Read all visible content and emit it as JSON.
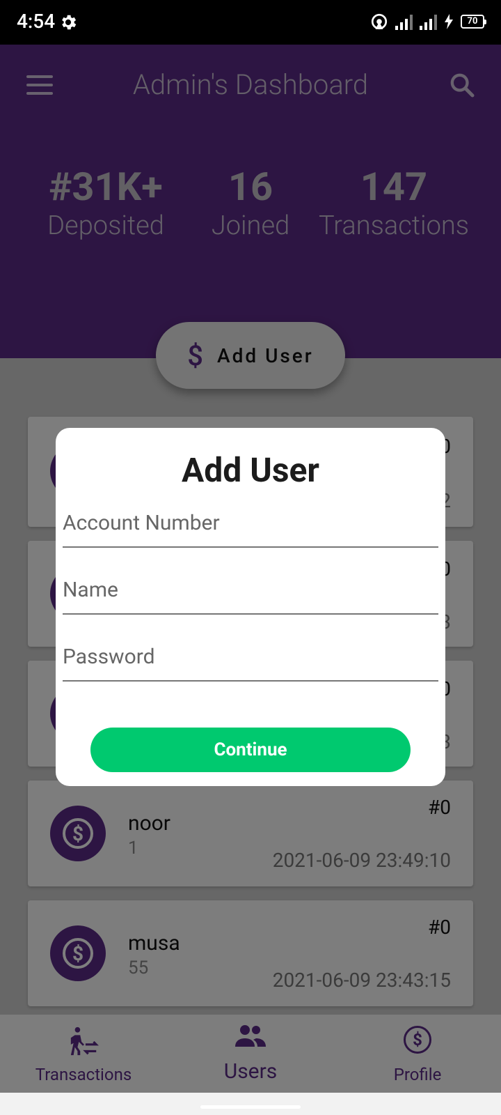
{
  "status_bar": {
    "time": "4:54",
    "battery": "70"
  },
  "header": {
    "title": "Admin's Dashboard"
  },
  "stats": [
    {
      "value": "#31K+",
      "label": "Deposited"
    },
    {
      "value": "16",
      "label": "Joined"
    },
    {
      "value": "147",
      "label": "Transactions"
    }
  ],
  "add_user_button": {
    "icon": "$",
    "label": "Add User"
  },
  "users": [
    {
      "name": "",
      "sub": "",
      "amount": "#0",
      "date": "2"
    },
    {
      "name": "",
      "sub": "",
      "amount": "#0",
      "date": "3"
    },
    {
      "name": "",
      "sub": "",
      "amount": "#0",
      "date": "3"
    },
    {
      "name": "noor",
      "sub": "1",
      "amount": "#0",
      "date": "2021-06-09 23:49:10"
    },
    {
      "name": "musa",
      "sub": "55",
      "amount": "#0",
      "date": "2021-06-09 23:43:15"
    }
  ],
  "bottom_nav": [
    {
      "label": "Transactions"
    },
    {
      "label": "Users"
    },
    {
      "label": "Profile"
    }
  ],
  "dialog": {
    "title": "Add User",
    "fields": [
      {
        "placeholder": "Account Number",
        "value": ""
      },
      {
        "placeholder": "Name",
        "value": ""
      },
      {
        "placeholder": "Password",
        "value": ""
      }
    ],
    "continue_label": "Continue"
  },
  "colors": {
    "primary": "#5b2a86",
    "accent": "#00c96f"
  }
}
